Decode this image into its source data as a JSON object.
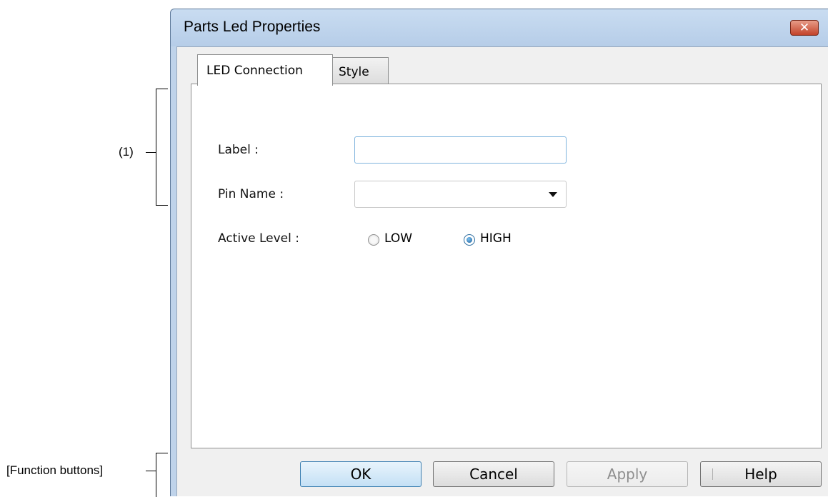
{
  "annotations": {
    "section_1": "(1)",
    "function_buttons": "[Function buttons]"
  },
  "dialog": {
    "title": "Parts Led Properties",
    "close_glyph": "✕",
    "tabs": [
      {
        "label": "LED Connection",
        "active": true
      },
      {
        "label": "Style",
        "active": false
      }
    ],
    "form": {
      "label_field": {
        "label": "Label :",
        "value": ""
      },
      "pin_name": {
        "label": "Pin Name :",
        "value": ""
      },
      "active_level": {
        "label": "Active Level :",
        "options": [
          "LOW",
          "HIGH"
        ],
        "selected": "HIGH"
      }
    },
    "buttons": {
      "ok": "OK",
      "cancel": "Cancel",
      "apply": "Apply",
      "help": "Help"
    }
  },
  "colors": {
    "title_bar": "#bfd3ea",
    "close_button": "#c3432a",
    "focus_border": "#3c7fb1"
  }
}
